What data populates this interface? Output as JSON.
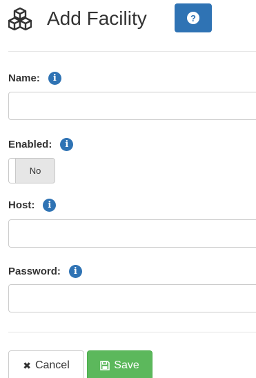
{
  "header": {
    "title": "Add Facility",
    "title_icon": "cubes-icon",
    "help_label": "?"
  },
  "fields": {
    "name": {
      "label": "Name:",
      "value": "",
      "placeholder": ""
    },
    "enabled": {
      "label": "Enabled:",
      "toggle_state": "No"
    },
    "host": {
      "label": "Host:",
      "value": "",
      "placeholder": ""
    },
    "password": {
      "label": "Password:",
      "value": "",
      "placeholder": ""
    }
  },
  "info_icon_glyph": "i",
  "actions": {
    "cancel_label": "Cancel",
    "cancel_icon": "close-icon",
    "save_label": "Save",
    "save_icon": "floppy-disk-icon"
  },
  "colors": {
    "primary": "#2f73b4",
    "success": "#5cb85c",
    "text": "#333333"
  }
}
